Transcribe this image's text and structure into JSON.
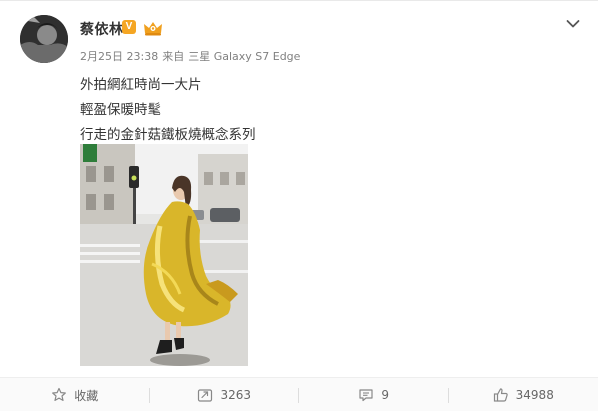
{
  "post": {
    "author": {
      "name": "蔡依林",
      "verified_badge": "V",
      "avatar_icon": "avatar-photo",
      "member_icon": "vip-member-icon"
    },
    "meta": {
      "date": "2月25日 23:38",
      "source_prefix": "来自",
      "device": "三星 Galaxy S7 Edge"
    },
    "text_lines": [
      "外拍網紅時尚一大片",
      "輕盈保暖時髦",
      "行走的金針菇鐵板燒概念系列"
    ],
    "image": {
      "icon": "street-photo-gold-cape"
    }
  },
  "actions": {
    "favorite": {
      "label": "收藏",
      "icon": "star-icon"
    },
    "repost": {
      "label": "3263",
      "icon": "repost-icon"
    },
    "comment": {
      "label": "9",
      "icon": "comment-icon"
    },
    "like": {
      "label": "34988",
      "icon": "thumbs-up-icon"
    }
  },
  "colors": {
    "badge": "#f5a623",
    "meta_text": "#808080",
    "body_text": "#333333",
    "gold": "#d9b62a"
  }
}
